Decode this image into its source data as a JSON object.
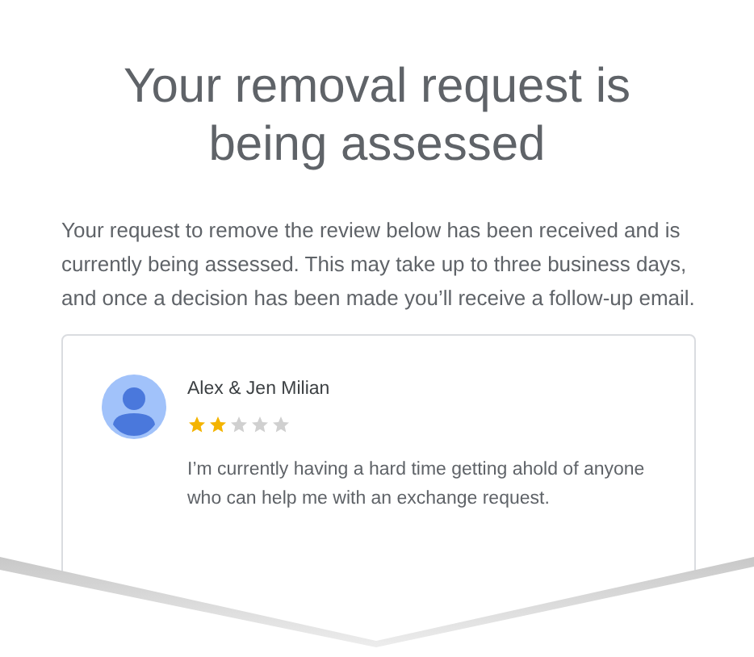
{
  "title": "Your removal request is being assessed",
  "message": "Your request to remove the review below has been received and is currently being assessed. This may take up to three business days, and once a decision has been made you’ll receive a follow-up email.",
  "review": {
    "author": "Alex & Jen Milian",
    "stars": 2,
    "text": "I’m currently having a hard time getting ahold of anyone who can help me with an exchange request."
  }
}
